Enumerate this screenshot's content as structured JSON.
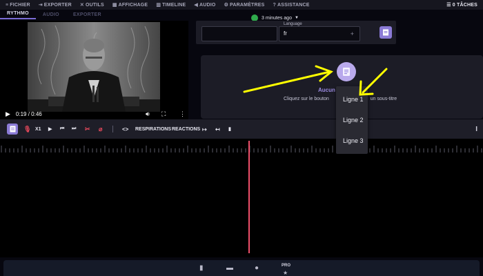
{
  "menu": {
    "items": [
      {
        "name": "menu-fichier",
        "icon": "menu-icon",
        "glyph": "≡",
        "label": "FICHIER"
      },
      {
        "name": "menu-exporter",
        "icon": "export-icon",
        "glyph": "⇥",
        "label": "EXPORTER"
      },
      {
        "name": "menu-outils",
        "icon": "tools-icon",
        "glyph": "✕",
        "label": "OUTILS"
      },
      {
        "name": "menu-affichage",
        "icon": "display-icon",
        "glyph": "▦",
        "label": "AFFICHAGE"
      },
      {
        "name": "menu-timeline",
        "icon": "timeline-icon",
        "glyph": "▥",
        "label": "TIMELINE"
      },
      {
        "name": "menu-audio",
        "icon": "speaker-icon",
        "glyph": "◀",
        "label": "AUDIO"
      },
      {
        "name": "menu-parametres",
        "icon": "sliders-icon",
        "glyph": "⚙",
        "label": "PARAMÈTRES"
      },
      {
        "name": "menu-assistance",
        "icon": "help-icon",
        "glyph": "?",
        "label": "ASSISTANCE"
      }
    ],
    "tasks_label": "0 TÂCHES"
  },
  "tabs": [
    {
      "label": "RYTHMO",
      "active": true
    },
    {
      "label": "AUDIO",
      "active": false
    },
    {
      "label": "EXPORTER",
      "active": false
    }
  ],
  "autosave": {
    "text": "3 minutes ago",
    "status_color": "#2faa4c"
  },
  "video": {
    "time": "0:19 / 0:46"
  },
  "language": {
    "label": "Language",
    "value": "fr"
  },
  "subtitle_panel": {
    "title": "Aucun",
    "hint": "Cliquez sur le bouton",
    "hint_end": "un sous-titre"
  },
  "toolbar": {
    "speed": "X1",
    "respirations": "RESPIRATIONS",
    "reactions": "REACTIONS"
  },
  "dropdown": {
    "items": [
      "Ligne 1",
      "Ligne 2",
      "Ligne 3"
    ]
  },
  "bottom": {
    "pro_label": "PRO"
  },
  "colors": {
    "accent": "#8b7bd6",
    "playhead": "#ee4f6a",
    "annotation": "#ffff00"
  }
}
